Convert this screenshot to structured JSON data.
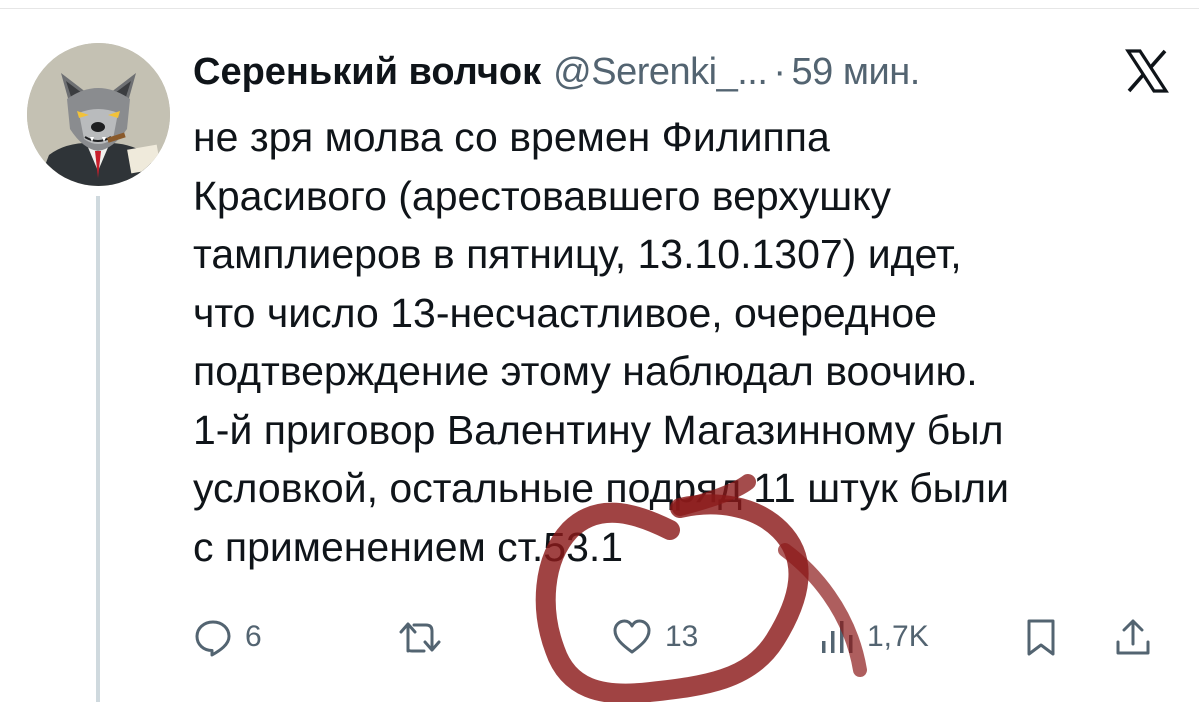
{
  "tweet": {
    "author": {
      "display_name": "Серенький волчок",
      "handle": "@Serenki_...",
      "separator": "·",
      "time": "59 мин."
    },
    "text_lines": [
      "не зря молва со времен Филиппа",
      "Красивого (арестовавшего верхушку",
      "тамплиеров в пятницу, 13.10.1307) идет,",
      "что число 13-несчастливое, очередное",
      "подтверждение этому наблюдал воочию.",
      "1-й приговор Валентину Магазинному был",
      "условкой, остальные подряд 11 штук были",
      "с применением ст.53.1"
    ],
    "actions": {
      "reply_count": "6",
      "like_count": "13",
      "views_count": "1,7K"
    }
  },
  "icons": {
    "platform_logo": "x-logo-icon",
    "reply": "comment-bubble-icon",
    "retweet": "retweet-arrows-icon",
    "like": "heart-icon",
    "views": "bar-chart-icon",
    "bookmark": "bookmark-icon",
    "share": "share-upload-icon"
  },
  "colors": {
    "text": "#0f1419",
    "secondary": "#536471",
    "thread_line": "#cfd9de",
    "annotation_marker": "#8b1a1a"
  }
}
